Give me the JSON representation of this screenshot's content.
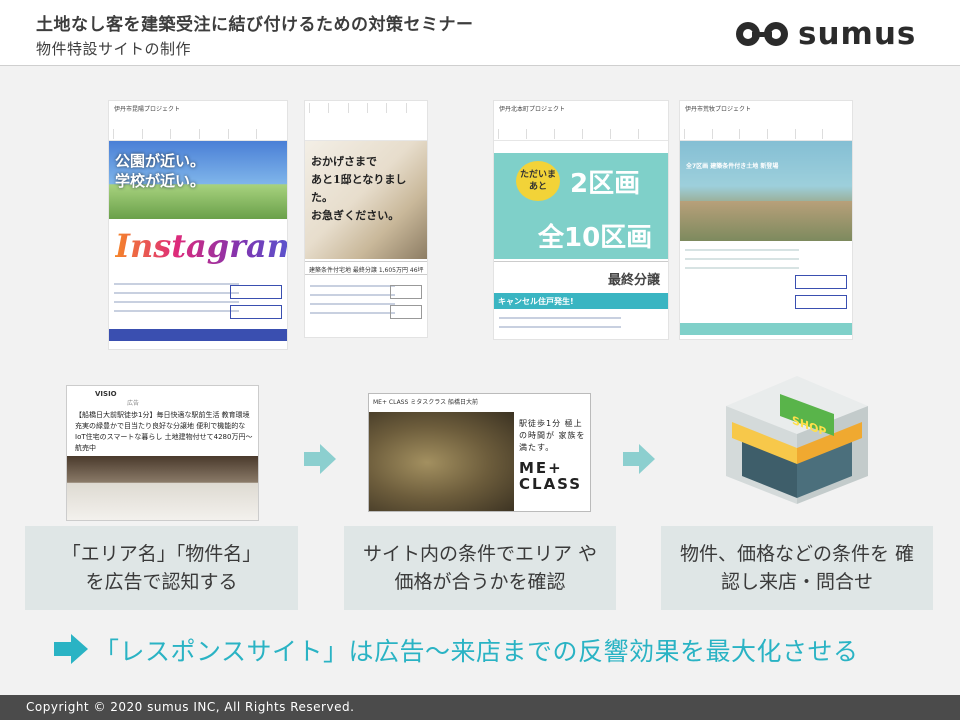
{
  "header": {
    "title": "土地なし客を建築受注に結び付けるための対策セミナー",
    "subtitle": "物件特設サイトの制作",
    "logo_text": "sumus"
  },
  "thumbnails": [
    {
      "site_title": "伊丹市昆陽プロジェクト",
      "hero_line1": "公園が近い。",
      "hero_line2": "学校が近い。",
      "banner_text": "Instagram"
    },
    {
      "hero_line1": "おかげさまで",
      "hero_line2": "あと1邸となりました。",
      "hero_line3": "お急ぎください。",
      "band_text": "建築条件付宅地 最終分譲 1,605万円 46坪"
    },
    {
      "site_title": "伊丹北本町プロジェクト",
      "badge_text": "ただいまあと",
      "big_line1": "2区画",
      "big_line2": "全10区画",
      "final_text": "最終分譲",
      "cancel_text": "キャンセル住戸発生!"
    },
    {
      "site_title": "伊丹市荒牧プロジェクト",
      "overlay_text": "全7区画 建築条件付き土地 新登場"
    }
  ],
  "ads": {
    "ad1_brand": "VISIO",
    "ad1_brand_sub": "広告",
    "ad1_body": "【船橋日大前駅徒歩1分】毎日快適な駅前生活 教育環境充実の緑豊かで目当たり良好な分譲地 便利で機能的なIoT住宅のスマートな暮らし 土地建物付せて4280万円～航売中",
    "ad2_logo": "ME+ CLASS ミタスクラス 船橋日大前",
    "ad2_copy": "駅徒歩1分 極上の時間が 家族を満たす。",
    "ad2_brand": "ME+ CLASS"
  },
  "shop_sign": "SHOP",
  "captions": [
    "「エリア名」「物件名」 を広告で認知する",
    "サイト内の条件でエリア や価格が合うかを確認",
    "物件、価格などの条件を 確認し来店・問合せ"
  ],
  "tagline": "「レスポンスサイト」は広告～来店までの反響効果を最大化させる",
  "footer": {
    "copyright": "Copyright © 2020 sumus INC, All Rights Reserved."
  },
  "colors": {
    "accent": "#2ab3c4",
    "arrow": "#8ccfcf",
    "caption_bg": "#dfe6e6",
    "footer_bg": "#4b4b4b"
  }
}
